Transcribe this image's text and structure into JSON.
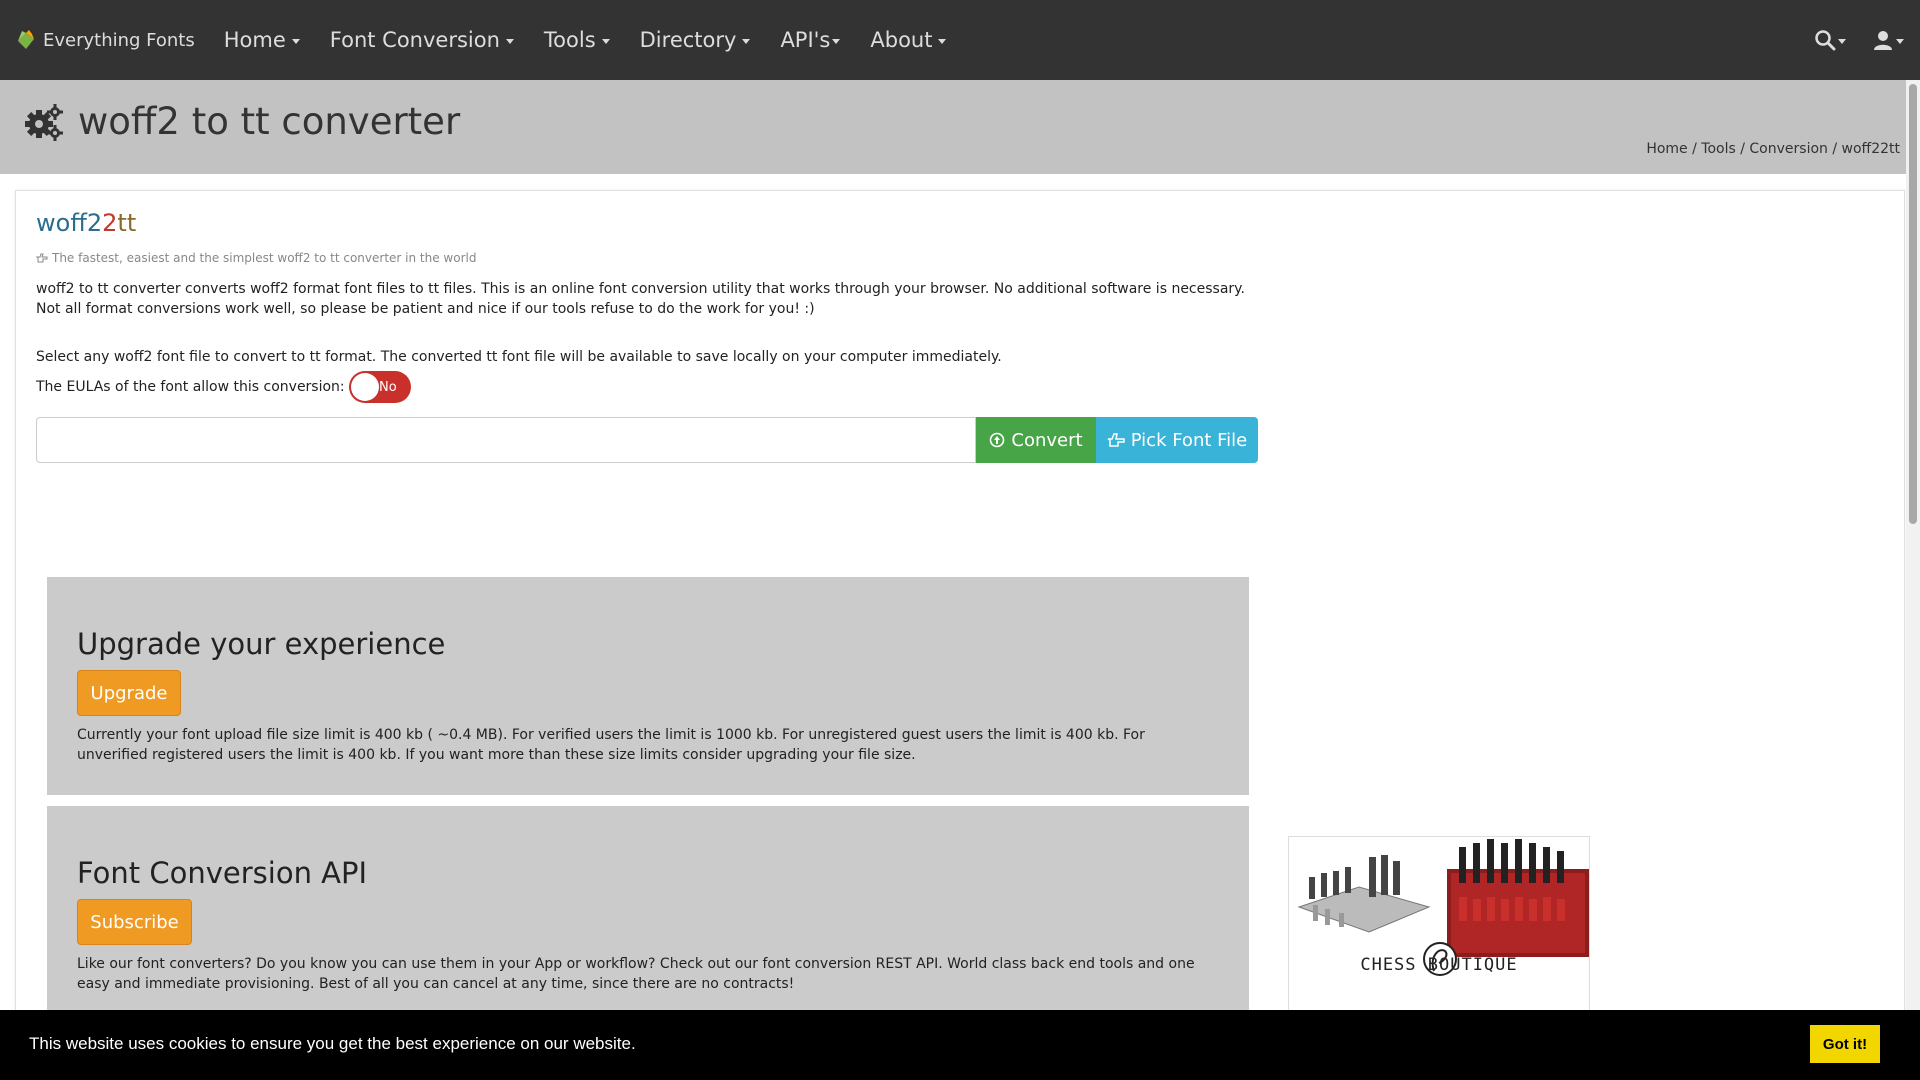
{
  "navbar": {
    "brand": "Everything Fonts",
    "items": [
      {
        "label": "Home"
      },
      {
        "label": "Font Conversion"
      },
      {
        "label": "Tools"
      },
      {
        "label": "Directory"
      },
      {
        "label": "API's"
      },
      {
        "label": "About"
      }
    ],
    "right_icons": [
      "search-icon",
      "user-icon"
    ]
  },
  "header": {
    "title": "woff2 to tt converter",
    "breadcrumb": [
      "Home",
      "Tools",
      "Conversion",
      "woff22tt"
    ]
  },
  "tool": {
    "title_part1": "woff2",
    "title_part2": "2",
    "title_part3": "tt",
    "tagline": "The fastest, easiest and the simplest woff2 to tt converter in the world",
    "description": "woff2 to tt converter converts woff2 format font files to tt files. This is an online font conversion utility that works through your browser. No additional software is necessary. Not all format conversions work well, so please be patient and nice if our tools refuse to do the work for you! :)",
    "select_text": "Select any woff2 font file to convert to tt format. The converted tt font file will be available to save locally on your computer immediately.",
    "eula_label": "The EULAs of the font allow this conversion:",
    "eula_toggle": "No",
    "file_input_value": "",
    "convert_label": "Convert",
    "pick_label": "Pick Font File"
  },
  "upgrade": {
    "title": "Upgrade your experience",
    "button": "Upgrade",
    "text": "Currently your font upload file size limit is 400 kb ( ~0.4 MB). For verified users the limit is 1000 kb. For unregistered guest users the limit is 400 kb. For unverified registered users the limit is 400 kb. If you want more than these size limits consider upgrading your file size."
  },
  "api": {
    "title": "Font Conversion API",
    "button": "Subscribe",
    "text": "Like our font converters? Do you know you can use them in your App or workflow? Check out our font conversion REST API. World class back end tools and one easy and immediate provisioning. Best of all you can cancel at any time, since there are no contracts!"
  },
  "ad": {
    "caption": "CHESS BOUTIQUE"
  },
  "cookie": {
    "text": "This website uses cookies to ensure you get the best experience on our website.",
    "button": "Got it!"
  },
  "colors": {
    "navbar_bg": "#333333",
    "header_bg": "#c2c2c2",
    "convert_green": "#47a447",
    "pick_blue": "#39b3d7",
    "orange": "#ef9a22",
    "toggle_red": "#c9302c",
    "cookie_btn": "#f1d600"
  }
}
